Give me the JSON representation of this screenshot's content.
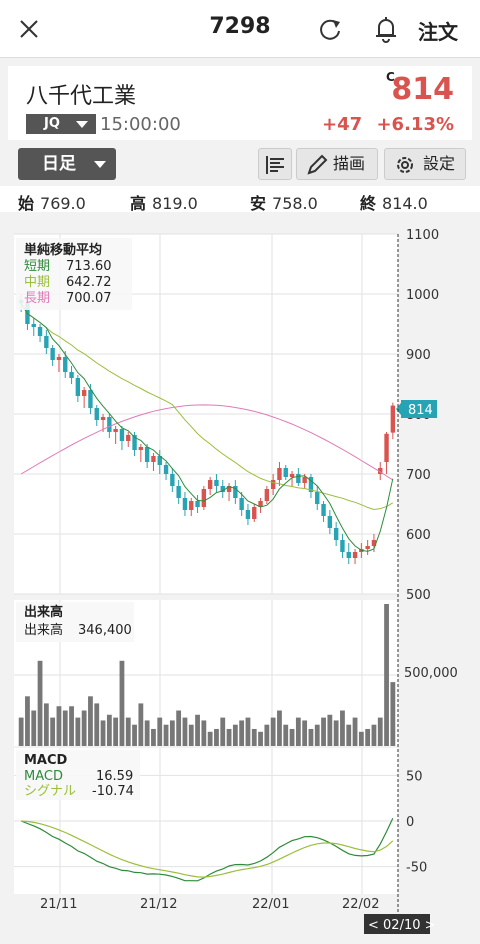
{
  "header": {
    "title": "7298",
    "order_label": "注文"
  },
  "stock": {
    "name": "八千代工業",
    "market": "JQ",
    "time": "15:00:00",
    "close_marker": "C",
    "price": "814",
    "change": "+47",
    "change_pct": "+6.13%"
  },
  "toolbar": {
    "period": "日足",
    "draw_label": "描画",
    "settings_label": "設定"
  },
  "ohlc": {
    "open_label": "始",
    "open": "769.0",
    "high_label": "高",
    "high": "819.0",
    "low_label": "安",
    "low": "758.0",
    "close_label": "終",
    "close": "814.0"
  },
  "colors": {
    "up": "#d9534f",
    "down": "#27a4b3",
    "short": "#2e8b3a",
    "mid": "#9bbf3a",
    "long": "#e07ab8"
  },
  "price_panel": {
    "title": "単純移動平均",
    "legend": [
      {
        "name": "短期",
        "value": "713.60",
        "color": "#2e8b3a"
      },
      {
        "name": "中期",
        "value": "642.72",
        "color": "#9bbf3a"
      },
      {
        "name": "長期",
        "value": "700.07",
        "color": "#e07ab8"
      }
    ],
    "yticks": [
      "1100",
      "1000",
      "900",
      "800",
      "700",
      "600",
      "500"
    ],
    "current_price_tag": "814"
  },
  "volume_panel": {
    "title": "出来高",
    "label": "出来高",
    "value": "346,400",
    "ytick": "500,000"
  },
  "macd_panel": {
    "title": "MACD",
    "legend": [
      {
        "name": "MACD",
        "value": "16.59",
        "color": "#2e8b3a"
      },
      {
        "name": "シグナル",
        "value": "-10.74",
        "color": "#9bbf3a"
      }
    ],
    "yticks": [
      "50",
      "0",
      "-50"
    ]
  },
  "xaxis": {
    "ticks": [
      "21/11",
      "21/12",
      "22/01",
      "22/02"
    ],
    "cursor_label": "< 02/10 >"
  },
  "chart_data": {
    "type": "candlestick",
    "dates_start_label": "21/11",
    "price_ylim": [
      500,
      1100
    ],
    "candles": [
      [
        990,
        1000,
        970,
        985
      ],
      [
        985,
        995,
        940,
        950
      ],
      [
        950,
        960,
        930,
        945
      ],
      [
        945,
        950,
        920,
        930
      ],
      [
        930,
        940,
        900,
        910
      ],
      [
        910,
        915,
        880,
        890
      ],
      [
        890,
        900,
        870,
        895
      ],
      [
        895,
        905,
        860,
        870
      ],
      [
        870,
        880,
        850,
        860
      ],
      [
        860,
        865,
        820,
        830
      ],
      [
        830,
        845,
        810,
        840
      ],
      [
        840,
        850,
        800,
        810
      ],
      [
        810,
        815,
        780,
        790
      ],
      [
        790,
        800,
        770,
        795
      ],
      [
        795,
        800,
        760,
        770
      ],
      [
        770,
        780,
        750,
        775
      ],
      [
        775,
        780,
        740,
        755
      ],
      [
        755,
        770,
        745,
        765
      ],
      [
        765,
        770,
        730,
        740
      ],
      [
        740,
        750,
        720,
        745
      ],
      [
        745,
        750,
        710,
        720
      ],
      [
        720,
        735,
        705,
        730
      ],
      [
        730,
        740,
        700,
        715
      ],
      [
        715,
        720,
        690,
        700
      ],
      [
        700,
        710,
        670,
        680
      ],
      [
        680,
        690,
        650,
        660
      ],
      [
        660,
        670,
        630,
        640
      ],
      [
        640,
        660,
        630,
        655
      ],
      [
        655,
        665,
        635,
        645
      ],
      [
        645,
        680,
        640,
        675
      ],
      [
        675,
        695,
        665,
        690
      ],
      [
        690,
        700,
        670,
        680
      ],
      [
        680,
        690,
        660,
        670
      ],
      [
        670,
        685,
        655,
        680
      ],
      [
        680,
        690,
        650,
        660
      ],
      [
        660,
        670,
        630,
        640
      ],
      [
        640,
        650,
        615,
        625
      ],
      [
        625,
        650,
        620,
        645
      ],
      [
        645,
        660,
        635,
        655
      ],
      [
        655,
        680,
        650,
        675
      ],
      [
        675,
        700,
        665,
        690
      ],
      [
        690,
        720,
        680,
        710
      ],
      [
        710,
        715,
        690,
        695
      ],
      [
        695,
        705,
        680,
        700
      ],
      [
        700,
        710,
        680,
        685
      ],
      [
        685,
        700,
        675,
        695
      ],
      [
        695,
        700,
        660,
        670
      ],
      [
        670,
        680,
        640,
        650
      ],
      [
        650,
        655,
        620,
        630
      ],
      [
        630,
        640,
        600,
        610
      ],
      [
        610,
        620,
        580,
        590
      ],
      [
        590,
        600,
        560,
        570
      ],
      [
        570,
        585,
        550,
        560
      ],
      [
        560,
        575,
        550,
        570
      ],
      [
        570,
        585,
        560,
        575
      ],
      [
        575,
        590,
        565,
        580
      ],
      [
        580,
        600,
        570,
        590
      ],
      [
        700,
        720,
        690,
        710
      ],
      [
        720,
        770,
        700,
        767
      ],
      [
        769,
        819,
        758,
        814
      ]
    ],
    "volume": [
      0.2,
      0.35,
      0.25,
      0.6,
      0.3,
      0.2,
      0.28,
      0.25,
      0.28,
      0.2,
      0.25,
      0.35,
      0.3,
      0.18,
      0.22,
      0.2,
      0.6,
      0.2,
      0.15,
      0.3,
      0.18,
      0.12,
      0.2,
      0.15,
      0.18,
      0.25,
      0.2,
      0.15,
      0.22,
      0.18,
      0.1,
      0.12,
      0.2,
      0.12,
      0.15,
      0.18,
      0.2,
      0.12,
      0.1,
      0.15,
      0.2,
      0.25,
      0.15,
      0.12,
      0.2,
      0.18,
      0.12,
      0.15,
      0.2,
      0.22,
      0.18,
      0.25,
      0.15,
      0.2,
      0.1,
      0.12,
      0.15,
      0.2,
      1.0,
      0.45,
      0.36
    ],
    "volume_ylim": [
      0,
      1000000
    ],
    "macd_ylim": [
      -80,
      80
    ]
  }
}
